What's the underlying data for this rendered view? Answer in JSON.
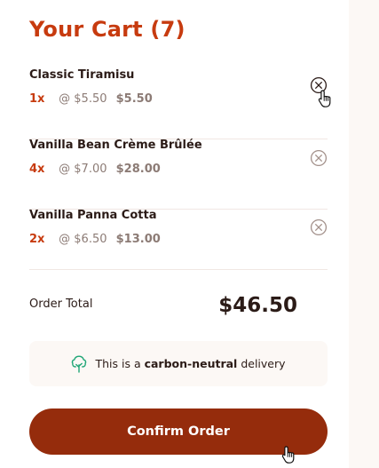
{
  "cart": {
    "title": "Your Cart (7)",
    "items": [
      {
        "name": "Classic Tiramisu",
        "quantity": "1x",
        "unit_price": "@ $5.50",
        "subtotal": "$5.50"
      },
      {
        "name": "Vanilla Bean Crème Brûlée",
        "quantity": "4x",
        "unit_price": "@ $7.00",
        "subtotal": "$28.00"
      },
      {
        "name": "Vanilla Panna Cotta",
        "quantity": "2x",
        "unit_price": "@ $6.50",
        "subtotal": "$13.00"
      }
    ],
    "order_total_label": "Order Total",
    "order_total_value": "$46.50",
    "carbon_note": {
      "prefix": "This is a ",
      "emphasis": "carbon-neutral",
      "suffix": " delivery",
      "icon": "tree-icon"
    },
    "confirm_label": "Confirm Order"
  },
  "colors": {
    "accent": "#c73b0f",
    "button": "#952c0c",
    "carbon_icon": "#1ea575",
    "background": "#fcf8f5"
  }
}
